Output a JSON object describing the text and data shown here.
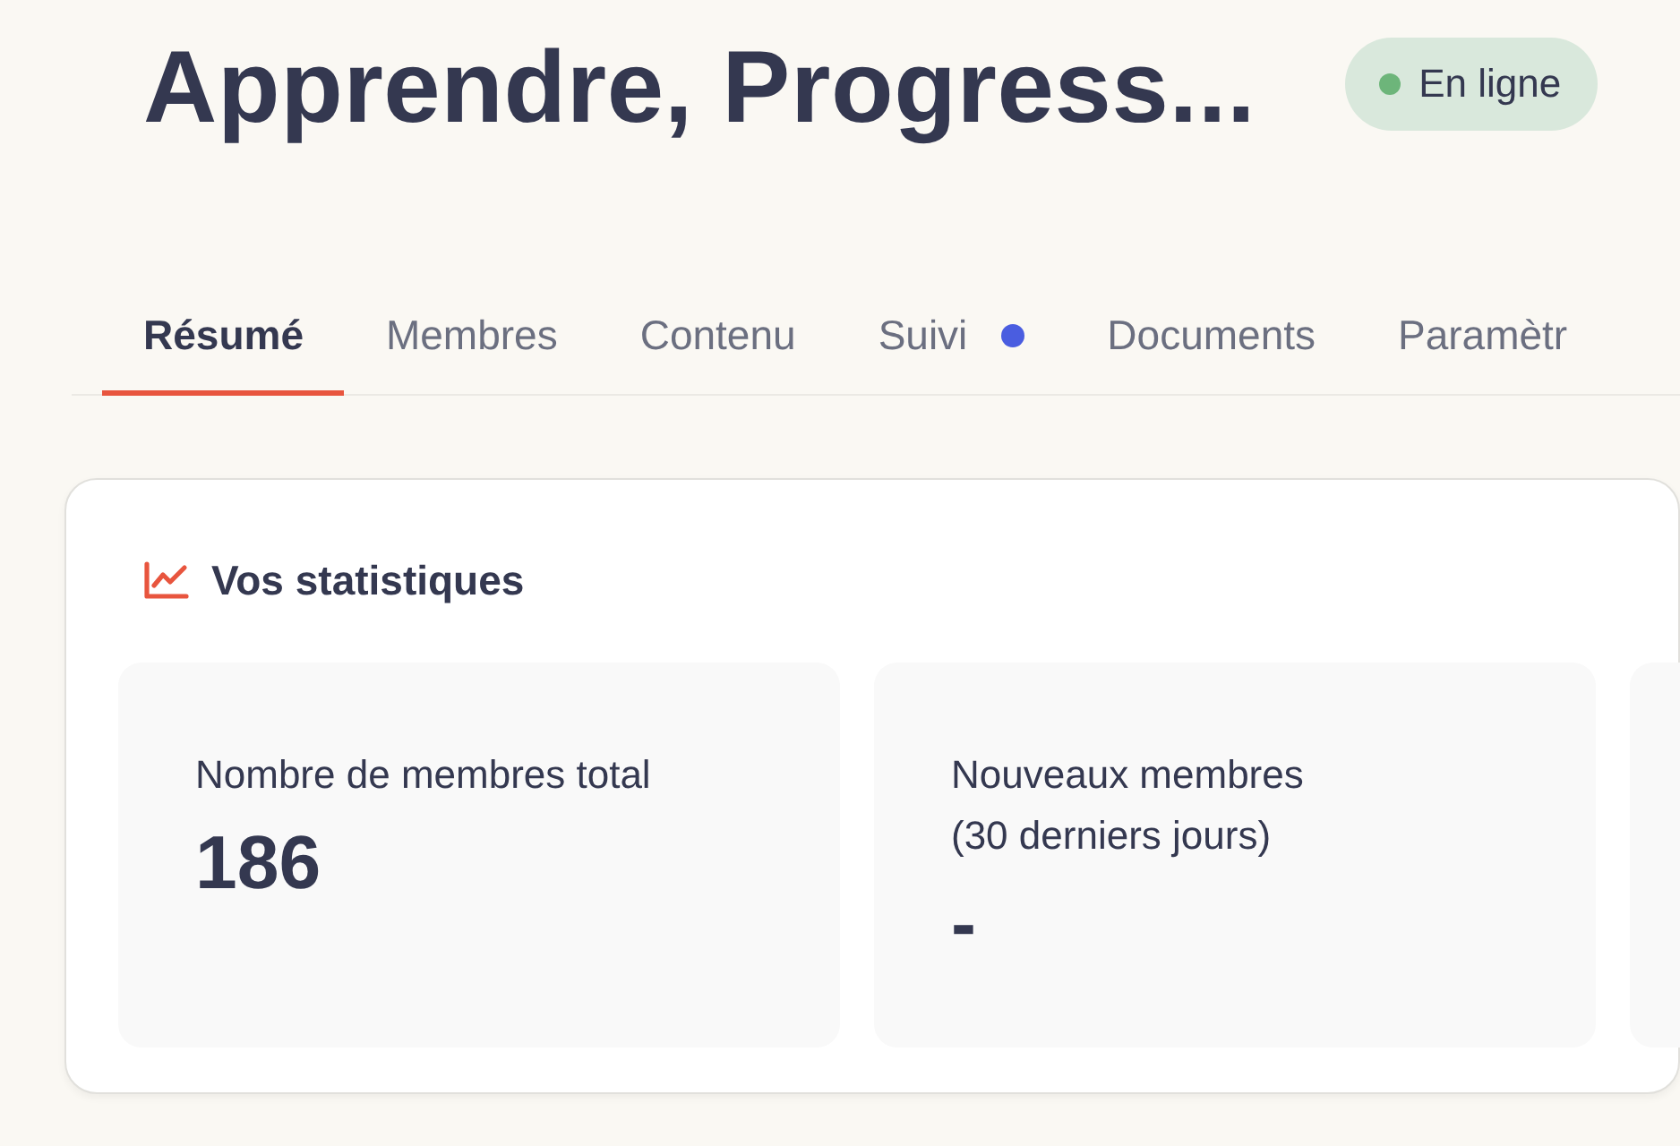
{
  "header": {
    "title": "Apprendre, Progress...",
    "status": {
      "label": "En ligne",
      "color": "#6db57a"
    }
  },
  "tabs": [
    {
      "label": "Résumé",
      "selected": true,
      "notification": false
    },
    {
      "label": "Membres",
      "selected": false,
      "notification": false
    },
    {
      "label": "Contenu",
      "selected": false,
      "notification": false
    },
    {
      "label": "Suivi",
      "selected": false,
      "notification": true
    },
    {
      "label": "Documents",
      "selected": false,
      "notification": false
    },
    {
      "label": "Paramètr",
      "selected": false,
      "notification": false
    }
  ],
  "stats_card": {
    "title": "Vos statistiques",
    "stats": [
      {
        "label": "Nombre de membres total",
        "value": "186"
      },
      {
        "label": "Nouveaux membres\n(30 derniers jours)",
        "value": "-"
      }
    ]
  }
}
